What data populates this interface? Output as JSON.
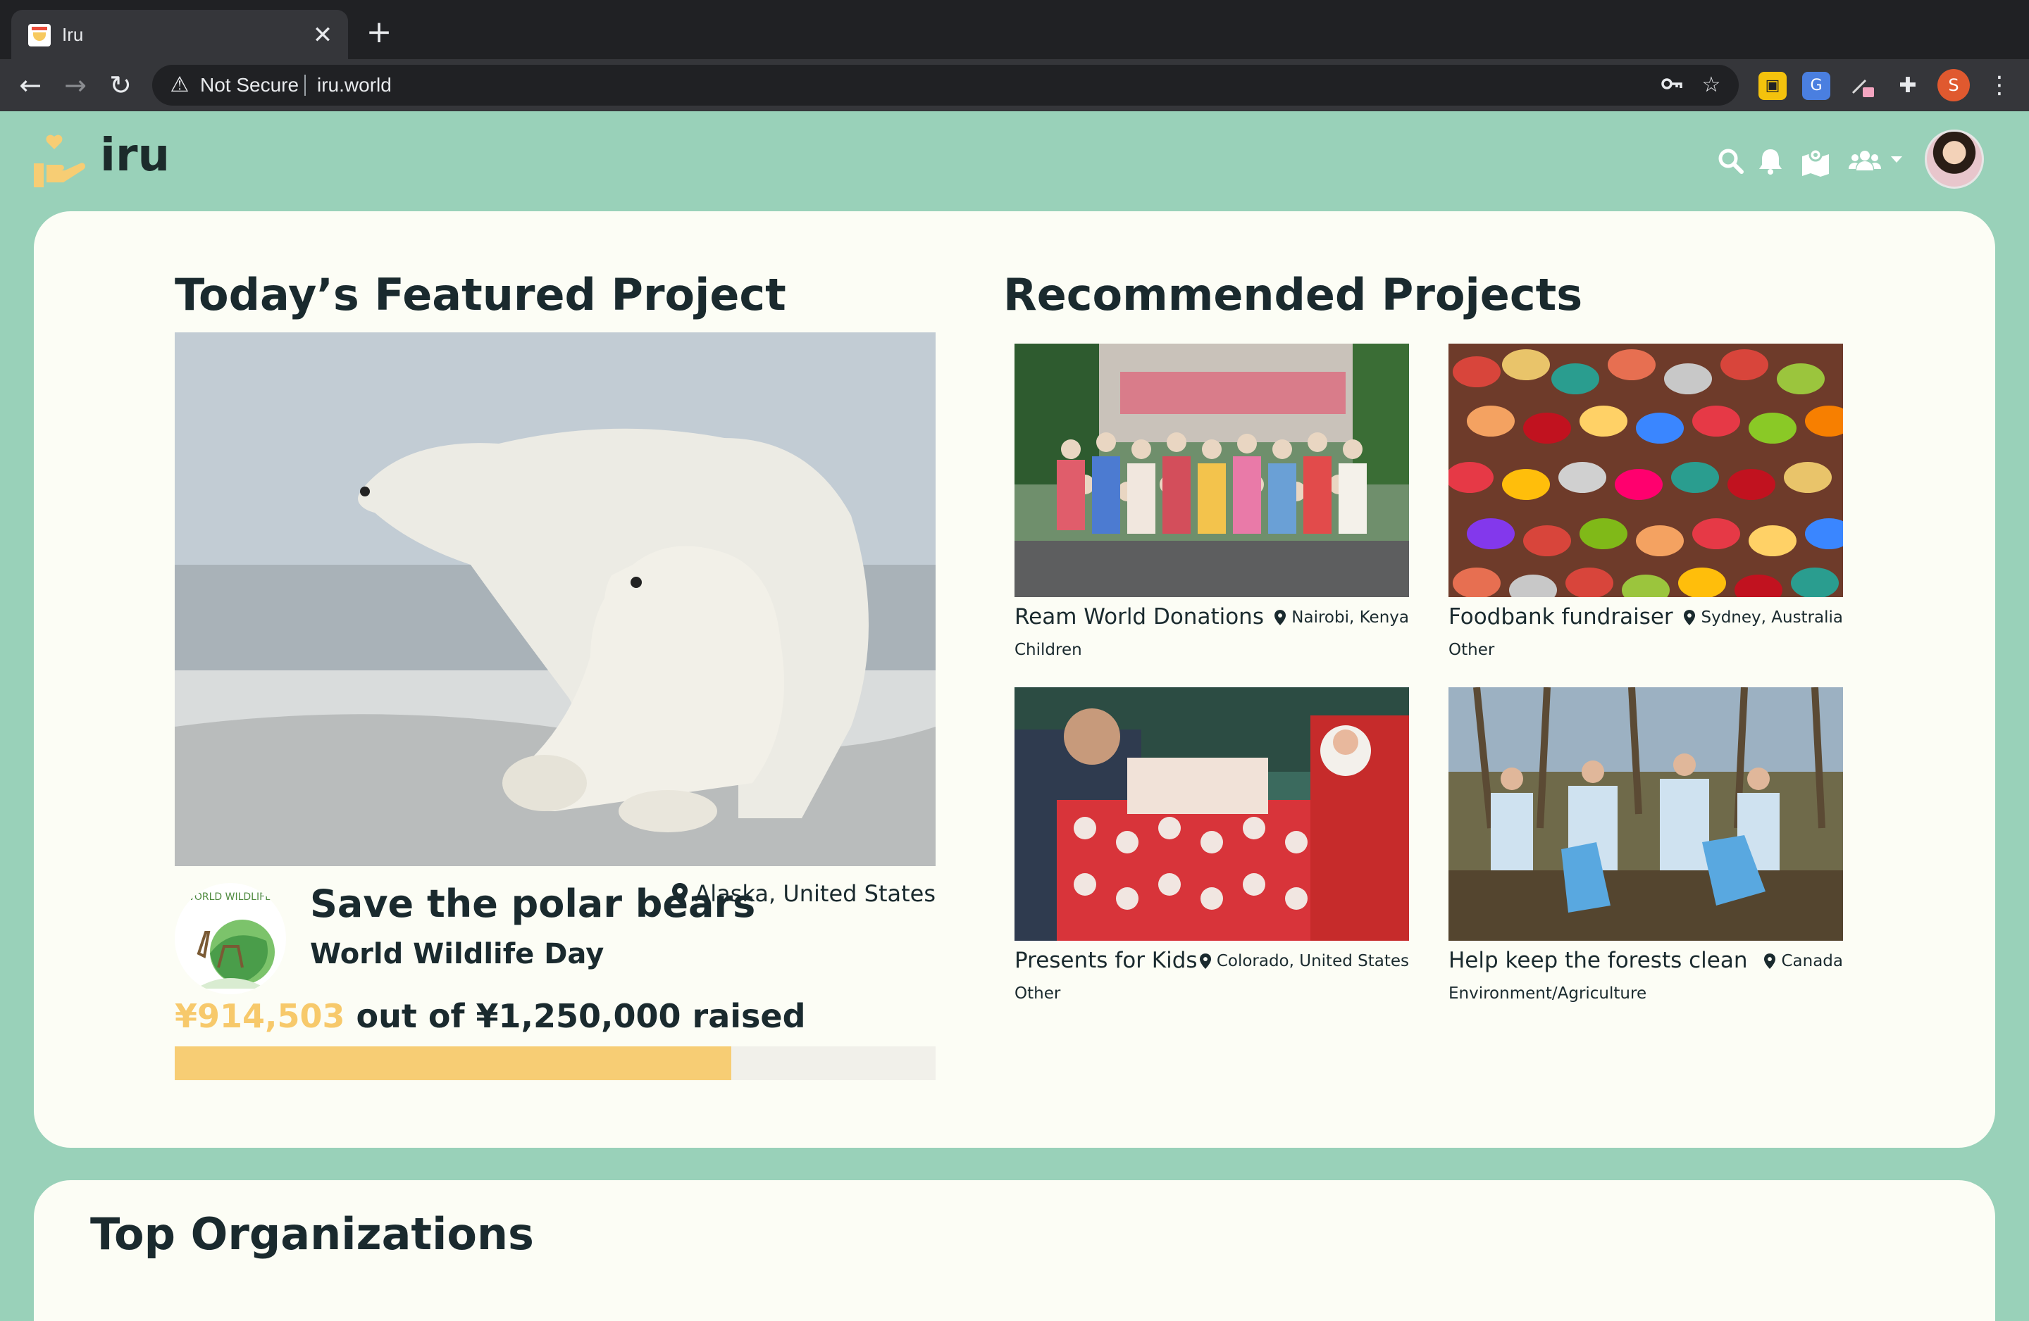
{
  "browser": {
    "tab_title": "Iru",
    "tab_close": "✕",
    "new_tab": "+",
    "security_label": "Not Secure",
    "url": "iru.world",
    "profile_initial": "S"
  },
  "site": {
    "logo_text": "iru",
    "header_icons": [
      "search-icon",
      "bell-icon",
      "map-icon",
      "users-icon"
    ]
  },
  "featured": {
    "heading": "Today’s Featured Project",
    "title": "Save the polar bears",
    "organization": "World Wildlife Day",
    "org_logo_text": "WORLD WILDLIFE DAY",
    "location": "Alaska, United States",
    "raised_amount": "¥914,503",
    "raised_suffix": "out of ¥1,250,000 raised",
    "progress_fraction": 0.7316
  },
  "recommended": {
    "heading": "Recommended Projects",
    "items": [
      {
        "title": "Ream World Donations",
        "location": "Nairobi, Kenya",
        "category": "Children"
      },
      {
        "title": "Foodbank fundraiser",
        "location": "Sydney, Australia",
        "category": "Other"
      },
      {
        "title": "Presents for Kids",
        "location": "Colorado, United States",
        "category": "Other"
      },
      {
        "title": "Help keep the forests clean",
        "location": "Canada",
        "category": "Environment/Agriculture"
      }
    ]
  },
  "top_orgs": {
    "heading": "Top Organizations"
  },
  "colors": {
    "page_bg": "#99d1b9",
    "card_bg": "#fcfdf5",
    "accent": "#f7cd74",
    "text": "#1a2a2e"
  }
}
